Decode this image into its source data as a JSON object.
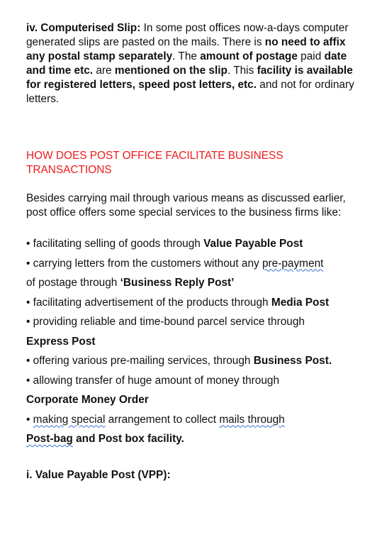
{
  "slip": {
    "label": "iv. Computerised Slip:",
    "t1": " In some post offices now-a-days computer generated slips are pasted on the mails. There is ",
    "b1": "no need to affix any postal stamp separately",
    "t2": ". The ",
    "b2": "amount of postage",
    "t3": " paid ",
    "b3": "date and time etc.",
    "t4": " are ",
    "b4": "mentioned on the slip",
    "t5": ". This ",
    "b5": "facility is available for registered letters, speed post letters, etc.",
    "t6": " and not for ordinary letters."
  },
  "heading": "HOW DOES POST OFFICE FACILITATE BUSINESS TRANSACTIONS",
  "intro": "Besides carrying mail through various means as discussed earlier, post office offers some special services to the business firms like:",
  "list": {
    "l1_text": "• facilitating selling of goods through ",
    "l1_bold": "Value Payable Post",
    "l2_text": "• carrying letters from the customers without any ",
    "l2_sq": "pre-payment",
    "l3_text": "of postage through ",
    "l3_bold": "‘Business Reply Post’",
    "l4_text": "• facilitating advertisement of the products through ",
    "l4_bold": "Media Post",
    "l5_text": "• providing reliable and time-bound parcel service through",
    "l6_bold": "Express Post",
    "l7_text": "• offering various pre-mailing services, through ",
    "l7_bold": "Business Post.",
    "l8_text": "• allowing transfer of huge amount of money through",
    "l9_bold": "Corporate Money Order",
    "l10_bullet": "• ",
    "l10_sq1": "making special",
    "l10_mid": " arrangement to collect ",
    "l10_sq2": "mails through ",
    "l11_sq": "Post-bag",
    "l11_bold": " and Post box facility."
  },
  "vpp_heading": "i. Value Payable Post (VPP):"
}
